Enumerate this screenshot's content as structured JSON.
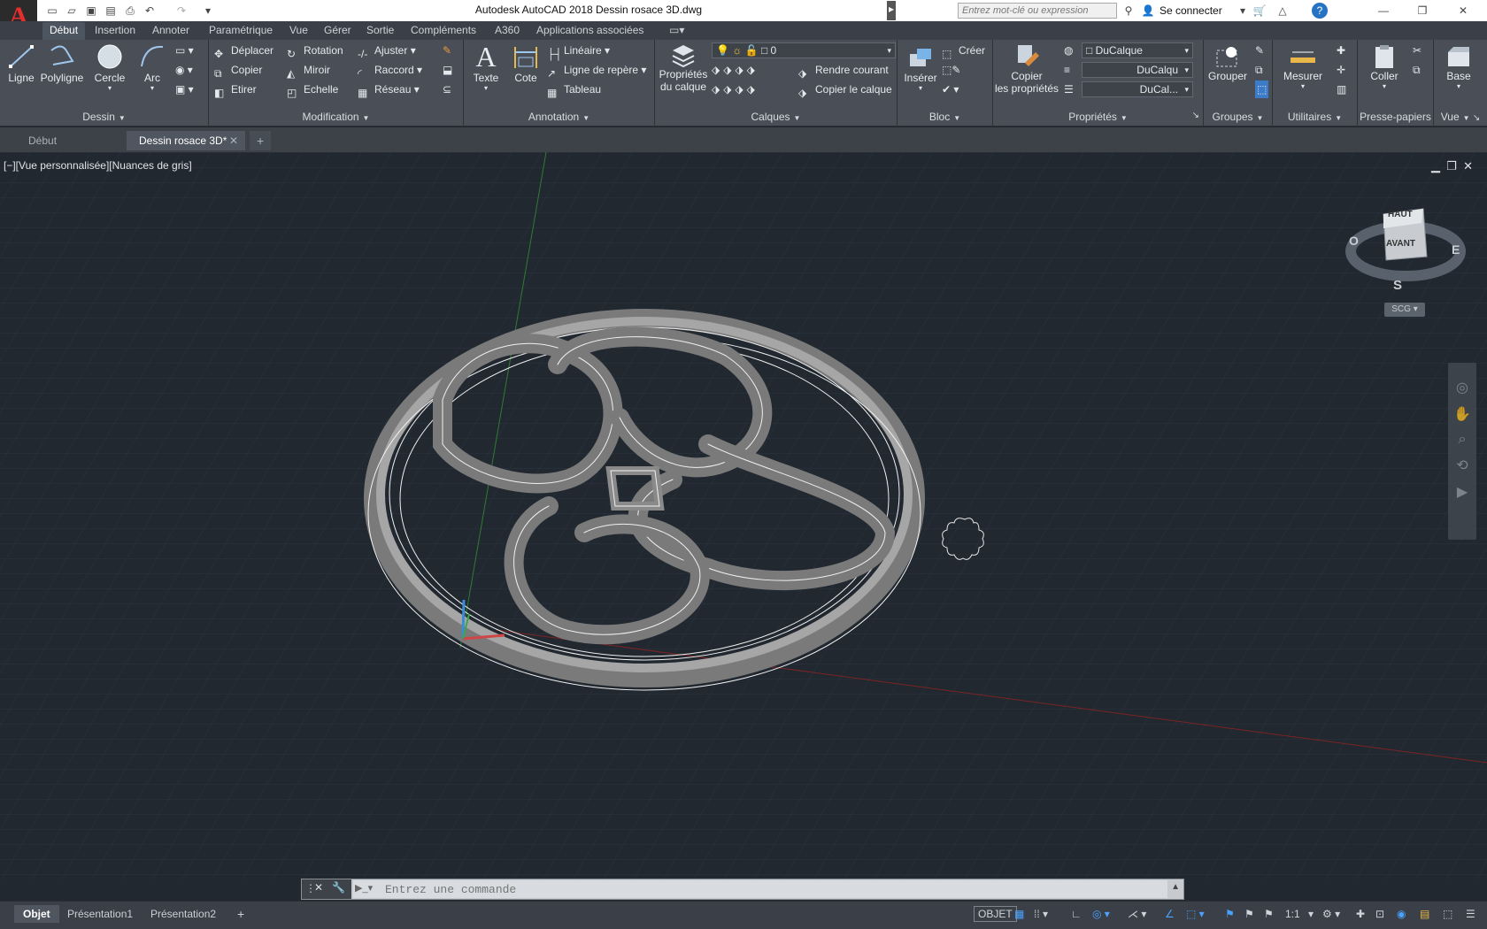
{
  "app": {
    "title": "Autodesk AutoCAD 2018    Dessin rosace 3D.dwg",
    "logo": "A",
    "search_placeholder": "Entrez mot-clé ou expression",
    "signin": "Se connecter"
  },
  "ribbon_tabs": [
    "Début",
    "Insertion",
    "Annoter",
    "Paramétrique",
    "Vue",
    "Gérer",
    "Sortie",
    "Compléments",
    "A360",
    "Applications associées"
  ],
  "panels": {
    "dessin": {
      "title": "Dessin",
      "ligne": "Ligne",
      "polyligne": "Polyligne",
      "cercle": "Cercle",
      "arc": "Arc"
    },
    "modification": {
      "title": "Modification",
      "deplacer": "Déplacer",
      "rotation": "Rotation",
      "ajuster": "Ajuster",
      "copier": "Copier",
      "miroir": "Miroir",
      "raccord": "Raccord",
      "etirer": "Etirer",
      "echelle": "Echelle",
      "reseau": "Réseau"
    },
    "annotation": {
      "title": "Annotation",
      "texte": "Texte",
      "cote": "Cote",
      "lineaire": "Linéaire",
      "ligne_repere": "Ligne de repère",
      "tableau": "Tableau"
    },
    "calques": {
      "title": "Calques",
      "proprietes_1": "Propriétés",
      "proprietes_2": "du calque",
      "layer_value": "0",
      "rendre_courant": "Rendre courant",
      "copier_calque": "Copier le calque"
    },
    "bloc": {
      "title": "Bloc",
      "inserer": "Insérer",
      "creer": "Créer"
    },
    "proprietes": {
      "title": "Propriétés",
      "copier_1": "Copier",
      "copier_2": "les propriétés",
      "color": "DuCalque",
      "linetype": "DuCalqu",
      "lineweight": "DuCal..."
    },
    "groupes": {
      "title": "Groupes",
      "grouper": "Grouper"
    },
    "utilitaires": {
      "title": "Utilitaires",
      "mesurer": "Mesurer"
    },
    "presse": {
      "title": "Presse-papiers",
      "coller": "Coller"
    },
    "vue": {
      "title": "Vue",
      "base": "Base"
    }
  },
  "doc_tabs": [
    "Début",
    "Dessin rosace 3D*"
  ],
  "viewport": {
    "label": "[−][Vue personnalisée][Nuances de gris]",
    "cube_top": "HAUT",
    "cube_front": "AVANT",
    "compass_w": "O",
    "compass_e": "E",
    "compass_s": "S",
    "ucs": "SCG"
  },
  "command": {
    "placeholder": "Entrez une commande"
  },
  "status": {
    "layout_tabs": [
      "Objet",
      "Présentation1",
      "Présentation2"
    ],
    "mode": "OBJET",
    "scale": "1:1"
  }
}
